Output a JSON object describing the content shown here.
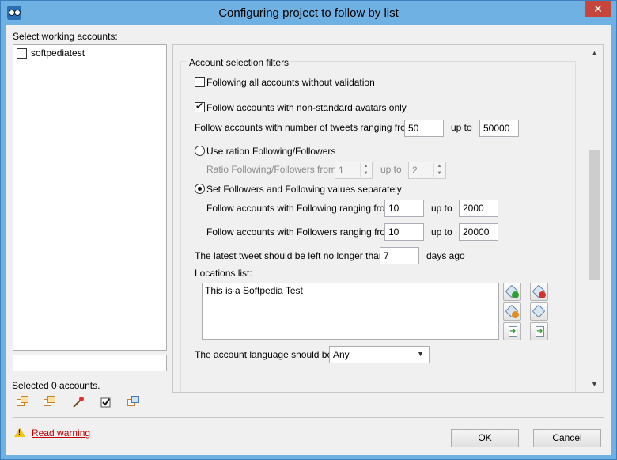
{
  "window": {
    "title": "Configuring project to follow by list",
    "close_label": "✕"
  },
  "left": {
    "header": "Select working accounts:",
    "accounts": [
      {
        "name": "softpediatest",
        "checked": false
      }
    ],
    "filter_value": "",
    "selected_status": "Selected 0 accounts."
  },
  "filters": {
    "group_title": "Account selection filters",
    "follow_all_label": "Following all accounts without validation",
    "follow_all_checked": false,
    "nonstandard_avatars_label": "Follow accounts with non-standard avatars only",
    "nonstandard_avatars_checked": true,
    "tweets_range_label": "Follow accounts with number of tweets ranging from:",
    "tweets_from": "50",
    "up_to_label": "up to",
    "tweets_to": "50000",
    "ratio_radio_label": "Use ration Following/Followers",
    "ratio_selected": false,
    "ratio_from_label": "Ratio Following/Followers from:",
    "ratio_from": "1",
    "ratio_to": "2",
    "separate_radio_label": "Set Followers and Following values separately",
    "separate_selected": true,
    "following_range_label": "Follow accounts with Following ranging from:",
    "following_from": "10",
    "following_to": "2000",
    "followers_range_label": "Follow accounts with Followers ranging from:",
    "followers_from": "10",
    "followers_to": "20000",
    "latest_tweet_label": "The latest tweet should be left no longer than:",
    "latest_tweet_days": "7",
    "days_ago_label": "days ago",
    "locations_label": "Locations list:",
    "locations_text": "This is a Softpedia Test",
    "language_label": "The account language should be:",
    "language_value": "Any"
  },
  "footer": {
    "warning_link": "Read warning",
    "ok_label": "OK",
    "cancel_label": "Cancel"
  },
  "colors": {
    "title_bar": "#6fb1e3",
    "close_button": "#c7463b",
    "warning_link": "#c00000"
  }
}
